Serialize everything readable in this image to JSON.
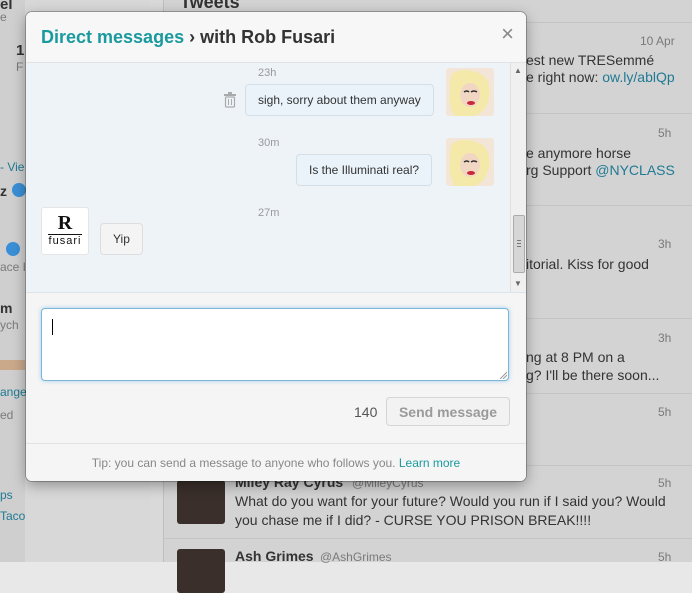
{
  "background": {
    "left_sidebar": [
      "el",
      "e",
      "1",
      "F",
      "- Vie",
      "z",
      "ace I",
      "m",
      "ych",
      "ange",
      "ed",
      "ps",
      "Taco"
    ],
    "timeline_header": "Tweets",
    "tweets": [
      {
        "time": "10 Apr",
        "line1": "est new TRESemmé",
        "line2_text": "e right now: ",
        "line2_link": "ow.ly/ablQp"
      },
      {
        "time": "5h",
        "line1": "e anymore horse",
        "line2_text": "rg Support ",
        "line2_link": "@NYCLASS"
      },
      {
        "time": "3h",
        "line1": "itorial. Kiss for good",
        "line2_text": "",
        "line2_link": ""
      },
      {
        "time": "3h",
        "line1": "ng at 8 PM on a",
        "line2_text": "g? I'll be there soon...",
        "line2_link": ""
      },
      {
        "time": "5h",
        "line1": "",
        "line2_text": "",
        "line2_link": ""
      },
      {
        "time": "5h",
        "name": "Miley Ray Cyrus",
        "handle": "@MileyCyrus",
        "line1": "What do you want for your future? Would you run if I said you? Would",
        "line2_text": "you chase me if I did? - CURSE YOU PRISON BREAK!!!!",
        "line2_link": ""
      },
      {
        "time": "5h",
        "name": "Ash Grimes",
        "handle": "@AshGrimes",
        "line1": "",
        "line2_text": "",
        "line2_link": ""
      }
    ]
  },
  "modal": {
    "title_link": "Direct messages",
    "title_rest": " › with Rob Fusari",
    "close_glyph": "×",
    "messages": [
      {
        "time": "23h",
        "text": "sigh, sorry about them anyway",
        "direction": "out"
      },
      {
        "time": "30m",
        "text": "Is the Illuminati real?",
        "direction": "out"
      },
      {
        "time": "27m",
        "text": "Yip",
        "direction": "in"
      }
    ],
    "incoming_avatar": {
      "logo_letter": "R",
      "logo_word": "fusari"
    },
    "compose": {
      "value": "",
      "placeholder": ""
    },
    "char_count": "140",
    "send_label": "Send message",
    "footer_tip": "Tip: you can send a message to anyone who follows you. ",
    "footer_link": "Learn more"
  },
  "colors": {
    "accent": "#1a9a9e",
    "bubble_out": "#eaf3fa",
    "thread_bg": "#eef3f8",
    "focus_border": "#7bb6d4"
  },
  "icons": [
    "close-icon",
    "trash-icon",
    "scroll-up-icon",
    "scroll-down-icon",
    "resize-grip-icon",
    "verified-badge-icon"
  ]
}
